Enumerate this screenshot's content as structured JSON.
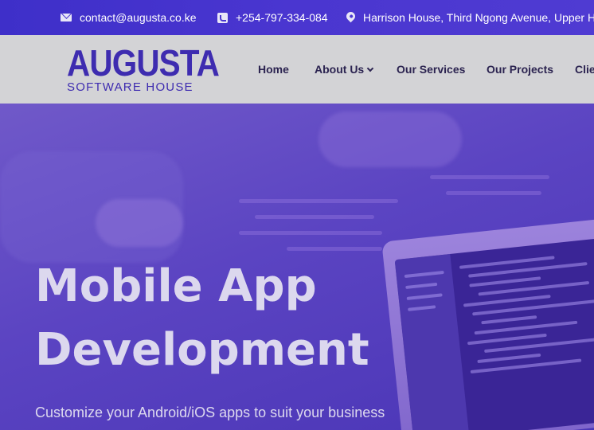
{
  "topbar": {
    "email": "contact@augusta.co.ke",
    "phone": "+254-797-334-084",
    "address": "Harrison House, Third Ngong Avenue, Upper Hill"
  },
  "logo": {
    "main": "AUGUSTA",
    "sub": "SOFTWARE HOUSE"
  },
  "nav": {
    "items": [
      "Home",
      "About Us",
      "Our Services",
      "Our Projects",
      "Clie"
    ]
  },
  "hero": {
    "title_line1": "Mobile App",
    "title_line2": "Development",
    "subtitle": "Customize your Android/iOS apps to suit your business"
  },
  "colors": {
    "topbar": "#4a36d0",
    "brand": "#3e2cb0",
    "header_bg": "#d3d3d6",
    "hero_overlay": "#5b44c2",
    "hero_text": "#dcd8ee"
  },
  "icons": {
    "email": "envelope-icon",
    "phone": "phone-icon",
    "address": "map-pin-icon",
    "dropdown": "chevron-down-icon"
  }
}
